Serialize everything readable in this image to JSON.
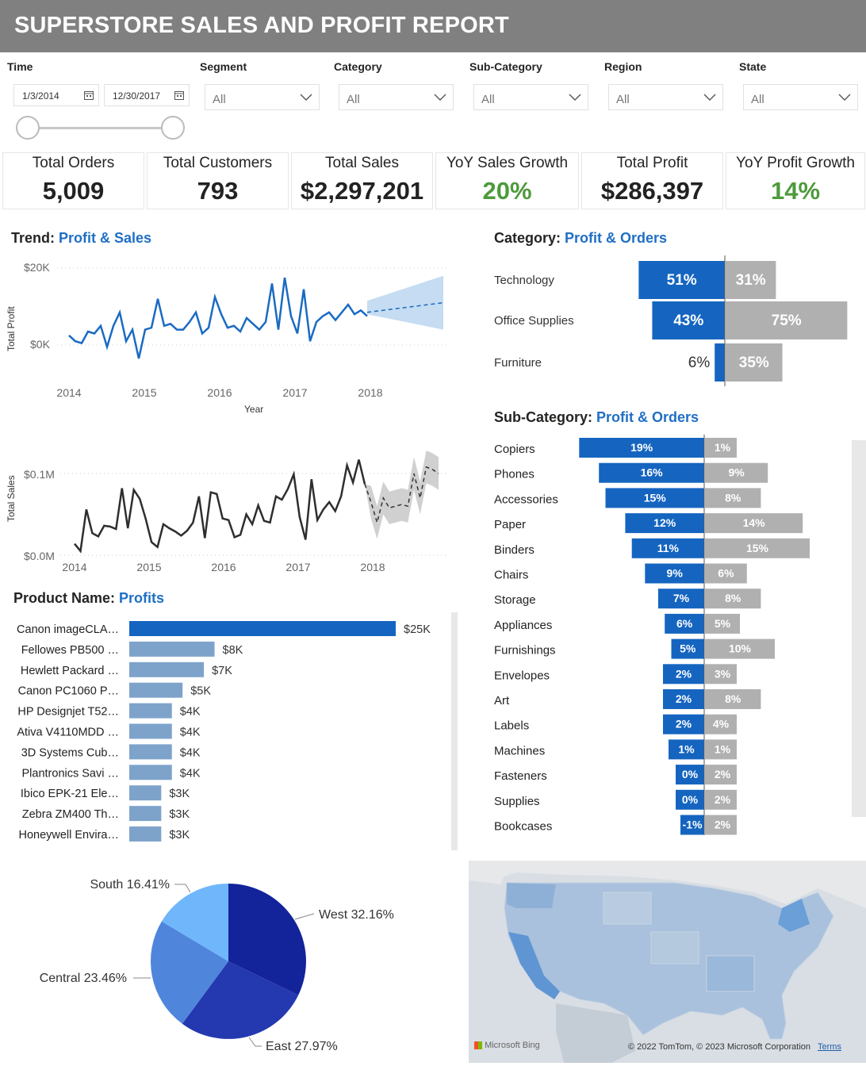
{
  "header": {
    "title": "SUPERSTORE SALES AND PROFIT REPORT"
  },
  "filters": {
    "time": {
      "label": "Time",
      "start": "1/3/2014",
      "end": "12/30/2017"
    },
    "segment": {
      "label": "Segment",
      "value": "All"
    },
    "category": {
      "label": "Category",
      "value": "All"
    },
    "subcategory": {
      "label": "Sub-Category",
      "value": "All"
    },
    "region": {
      "label": "Region",
      "value": "All"
    },
    "state": {
      "label": "State",
      "value": "All"
    }
  },
  "kpis": [
    {
      "label": "Total Orders",
      "value": "5,009"
    },
    {
      "label": "Total Customers",
      "value": "793"
    },
    {
      "label": "Total Sales",
      "value": "$2,297,201"
    },
    {
      "label": "YoY Sales Growth",
      "value": "20%"
    },
    {
      "label": "Total Profit",
      "value": "$286,397"
    },
    {
      "label": "YoY Profit Growth",
      "value": "14%"
    }
  ],
  "colors": {
    "accent": "#1f6fc5",
    "blue_bar": "#1565c0",
    "gray_bar": "#b0b0b0",
    "green": "#4e9a3c",
    "product_bar_top": "#1565c0",
    "product_bar": "#7ea3cb"
  },
  "trend": {
    "title_prefix": "Trend:",
    "title_highlight": "Profit & Sales"
  },
  "chart_data": [
    {
      "type": "line",
      "ylabel": "Total Profit",
      "xlabel": "Year",
      "x_ticks": [
        "2014",
        "2015",
        "2016",
        "2017",
        "2018"
      ],
      "y_ticks": [
        "$20K",
        "$0K"
      ],
      "ylim": [
        -5000,
        22000
      ],
      "series": [
        {
          "values": [
            2500,
            1000,
            500,
            3500,
            3000,
            5000,
            -500,
            5000,
            8500,
            1000,
            4000,
            -3500,
            4000,
            4500,
            12000,
            5000,
            5500,
            4000,
            4000,
            6000,
            8500,
            3000,
            4500,
            12500,
            8000,
            4500,
            5000,
            3500,
            7000,
            5500,
            4000,
            6000,
            16000,
            4000,
            17500,
            7500,
            3000,
            14500,
            1000,
            6000,
            7500,
            8500,
            6500,
            8500,
            10500,
            8000,
            9000,
            7500
          ]
        }
      ],
      "forecast": {
        "upper_start": 11500,
        "upper_end": 18000,
        "lower_start": 8000,
        "lower_end": 4000,
        "mid_start": 8500,
        "mid_end": 11000,
        "months": 12
      }
    },
    {
      "type": "line",
      "ylabel": "Total Sales",
      "x_ticks": [
        "2014",
        "2015",
        "2016",
        "2017",
        "2018"
      ],
      "y_ticks": [
        "$0.1M",
        "$0.0M"
      ],
      "ylim": [
        0,
        0.13
      ],
      "series": [
        {
          "values": [
            0.014,
            0.005,
            0.056,
            0.027,
            0.023,
            0.036,
            0.035,
            0.032,
            0.082,
            0.033,
            0.08,
            0.069,
            0.045,
            0.016,
            0.01,
            0.038,
            0.033,
            0.029,
            0.024,
            0.03,
            0.04,
            0.072,
            0.021,
            0.077,
            0.075,
            0.045,
            0.043,
            0.022,
            0.025,
            0.05,
            0.038,
            0.061,
            0.042,
            0.04,
            0.072,
            0.068,
            0.081,
            0.099,
            0.047,
            0.019,
            0.093,
            0.043,
            0.056,
            0.065,
            0.054,
            0.072,
            0.11,
            0.089,
            0.117,
            0.087
          ]
        }
      ],
      "forecast": {
        "values": [
          0.065,
          0.04,
          0.07,
          0.058,
          0.06,
          0.062,
          0.06,
          0.1,
          0.07,
          0.108,
          0.105,
          0.1
        ],
        "band": 0.02
      }
    },
    {
      "type": "bar",
      "title": "Category: Profit & Orders",
      "categories": [
        "Technology",
        "Office Supplies",
        "Furniture"
      ],
      "series": [
        {
          "name": "Profit",
          "values": [
            51,
            43,
            6
          ]
        },
        {
          "name": "Orders",
          "values": [
            31,
            75,
            35
          ]
        }
      ],
      "labels_left": [
        "51%",
        "43%",
        "6%"
      ],
      "labels_right": [
        "31%",
        "75%",
        "35%"
      ]
    },
    {
      "type": "bar",
      "title": "Sub-Category: Profit & Orders",
      "categories": [
        "Copiers",
        "Phones",
        "Accessories",
        "Paper",
        "Binders",
        "Chairs",
        "Storage",
        "Appliances",
        "Furnishings",
        "Envelopes",
        "Art",
        "Labels",
        "Machines",
        "Fasteners",
        "Supplies",
        "Bookcases"
      ],
      "series": [
        {
          "name": "Profit",
          "values": [
            19,
            16,
            15,
            12,
            11,
            9,
            7,
            6,
            5,
            2,
            2,
            2,
            1,
            0,
            0,
            -1
          ]
        },
        {
          "name": "Orders",
          "values": [
            1,
            9,
            8,
            14,
            15,
            6,
            8,
            5,
            10,
            3,
            8,
            4,
            1,
            2,
            2,
            2
          ]
        }
      ],
      "labels_left": [
        "19%",
        "16%",
        "15%",
        "12%",
        "11%",
        "9%",
        "7%",
        "6%",
        "5%",
        "2%",
        "2%",
        "2%",
        "1%",
        "0%",
        "0%",
        "-1%"
      ],
      "labels_right": [
        "1%",
        "9%",
        "8%",
        "14%",
        "15%",
        "6%",
        "8%",
        "5%",
        "10%",
        "3%",
        "8%",
        "4%",
        "1%",
        "2%",
        "2%",
        "2%"
      ]
    },
    {
      "type": "bar",
      "title": "Product Name: Profits",
      "categories": [
        "Canon imageCLA…",
        "Fellowes PB500 …",
        "Hewlett Packard …",
        "Canon PC1060 P…",
        "HP Designjet T52…",
        "Ativa V4110MDD …",
        "3D Systems Cub…",
        "Plantronics Savi …",
        "Ibico EPK-21 Ele…",
        "Zebra ZM400 Th…",
        "Honeywell Envira…"
      ],
      "values": [
        25,
        8,
        7,
        5,
        4,
        4,
        4,
        4,
        3,
        3,
        3
      ],
      "value_labels": [
        "$25K",
        "$8K",
        "$7K",
        "$5K",
        "$4K",
        "$4K",
        "$4K",
        "$4K",
        "$3K",
        "$3K",
        "$3K"
      ]
    },
    {
      "type": "pie",
      "categories": [
        "West",
        "East",
        "Central",
        "South"
      ],
      "values": [
        32.16,
        27.97,
        23.46,
        16.41
      ],
      "labels": [
        "West 32.16%",
        "East 27.97%",
        "Central 23.46%",
        "South 16.41%"
      ],
      "colors": [
        "#13239a",
        "#2438b0",
        "#4f86dc",
        "#70b6fb"
      ]
    }
  ],
  "titles": {
    "category": {
      "prefix": "Category:",
      "highlight": "Profit & Orders"
    },
    "subcategory": {
      "prefix": "Sub-Category:",
      "highlight": "Profit & Orders"
    },
    "product": {
      "prefix": "Product Name:",
      "highlight": "Profits"
    }
  },
  "map": {
    "attribution": "© 2022 TomTom, © 2023 Microsoft Corporation",
    "terms": "Terms",
    "brand": "Microsoft Bing"
  }
}
